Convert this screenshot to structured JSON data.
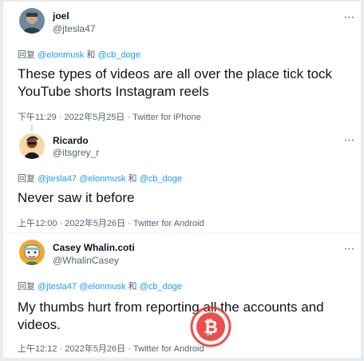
{
  "colors": {
    "accent": "#1d9bf0",
    "muted": "#536471",
    "text": "#0f1419",
    "watermark": "#e8332a"
  },
  "more_icon": "⋯",
  "tweets": [
    {
      "name": "joel",
      "handle": "@jtesla47",
      "reply_prefix": "回复",
      "mentions": [
        "@elonmusk",
        "@cb_doge"
      ],
      "joiner": " 和 ",
      "text": "These types of videos are all over the place tick tock YouTube shorts Instagram reels",
      "time": "下午11:29 · 2022年5月25日 · ",
      "source": "Twitter for iPhone"
    },
    {
      "name": "Ricardo",
      "handle": "@itsgrey_r",
      "reply_prefix": "回复",
      "mentions": [
        "@jtesla47",
        "@elonmusk",
        "@cb_doge"
      ],
      "joiner": " 和 ",
      "text": "Never saw it before",
      "time": "上午12:00 · 2022年5月26日 · ",
      "source": "Twitter for Android"
    },
    {
      "name": "Casey Whalin.coti",
      "handle": "@WhalinCasey",
      "reply_prefix": "回复",
      "mentions": [
        "@jtesla47",
        "@elonmusk",
        "@cb_doge"
      ],
      "joiner": " 和 ",
      "text": "My thumbs hurt from reporting all the accounts and videos.",
      "time": "上午12:12 · 2022年5月26日 · ",
      "source": "Twitter for Android"
    }
  ]
}
